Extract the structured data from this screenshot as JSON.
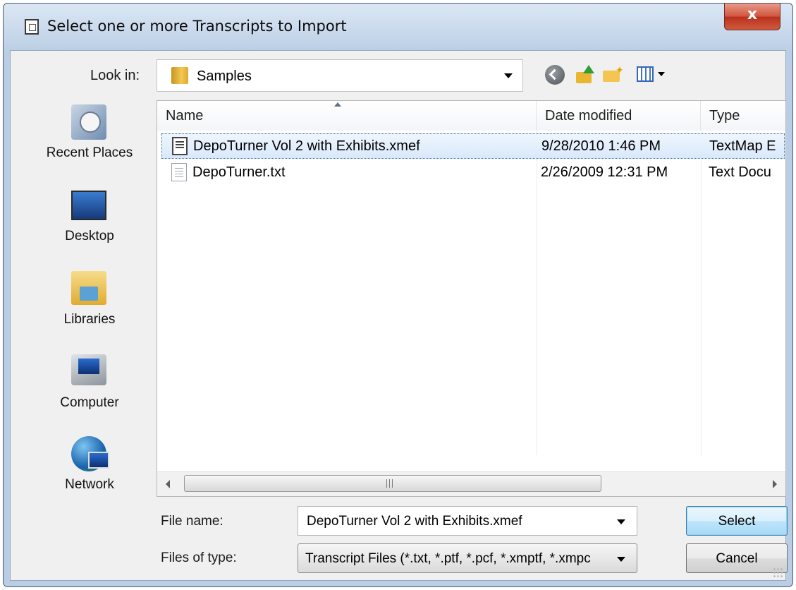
{
  "window": {
    "title": "Select one or more Transcripts to Import",
    "close_label": "x"
  },
  "toolbar": {
    "look_in_label": "Look in:",
    "look_in_value": "Samples",
    "icons": [
      "back-icon",
      "up-folder-icon",
      "new-folder-icon",
      "views-menu-icon"
    ]
  },
  "places": [
    {
      "label": "Recent Places",
      "icon": "recent-places-icon"
    },
    {
      "label": "Desktop",
      "icon": "desktop-icon"
    },
    {
      "label": "Libraries",
      "icon": "libraries-icon"
    },
    {
      "label": "Computer",
      "icon": "computer-icon"
    },
    {
      "label": "Network",
      "icon": "network-icon"
    }
  ],
  "file_list": {
    "columns": [
      "Name",
      "Date modified",
      "Type"
    ],
    "sorted_by": "Name",
    "rows": [
      {
        "name": "DepoTurner Vol 2 with Exhibits.xmef",
        "date": "9/28/2010 1:46 PM",
        "type": "TextMap E",
        "icon": "xmef-file-icon",
        "selected": true
      },
      {
        "name": "DepoTurner.txt",
        "date": "2/26/2009 12:31 PM",
        "type": "Text Docu",
        "icon": "text-file-icon",
        "selected": false
      }
    ],
    "scroll_grip": "III"
  },
  "form": {
    "file_name_label": "File name:",
    "file_name_value": "DepoTurner Vol 2 with Exhibits.xmef",
    "file_type_label": "Files of type:",
    "file_type_value": "Transcript Files (*.txt, *.ptf, *.pcf, *.xmptf, *.xmpc"
  },
  "buttons": {
    "select": "Select",
    "cancel": "Cancel"
  },
  "colors": {
    "selection": "#d9e9fb",
    "title_gradient": "#b9cde4",
    "close_button": "#c8432c",
    "default_button": "#bee6fd"
  }
}
